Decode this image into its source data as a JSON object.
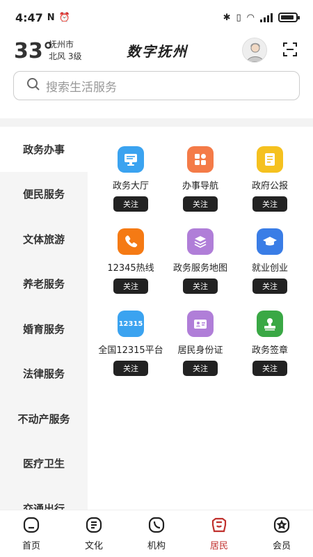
{
  "status_bar": {
    "time": "4:47"
  },
  "header": {
    "temperature": "33°",
    "city": "抚州市",
    "wind": "北风  3级",
    "app_title": "数字抚州"
  },
  "search": {
    "placeholder": "搜索生活服务"
  },
  "sidebar": {
    "items": [
      {
        "label": "政务办事",
        "active": true
      },
      {
        "label": "便民服务"
      },
      {
        "label": "文体旅游"
      },
      {
        "label": "养老服务"
      },
      {
        "label": "婚育服务"
      },
      {
        "label": "法律服务"
      },
      {
        "label": "不动产服务"
      },
      {
        "label": "医疗卫生"
      },
      {
        "label": "交通出行"
      }
    ]
  },
  "services": [
    {
      "label": "政务大厅",
      "icon": "monitor-icon",
      "color": "#3ba3f0",
      "follow": "关注"
    },
    {
      "label": "办事导航",
      "icon": "grid-apps-icon",
      "color": "#f47b48",
      "follow": "关注"
    },
    {
      "label": "政府公报",
      "icon": "document-icon",
      "color": "#f5c11f",
      "follow": "关注"
    },
    {
      "label": "12345热线",
      "icon": "phone-icon",
      "color": "#f57a14",
      "follow": "关注"
    },
    {
      "label": "政务服务地图",
      "icon": "layers-icon",
      "color": "#b07ed8",
      "follow": "关注"
    },
    {
      "label": "就业创业",
      "icon": "graduation-cap-icon",
      "color": "#3a7de6",
      "follow": "关注"
    },
    {
      "label": "全国12315平台",
      "icon": "badge-12315-icon",
      "icon_text": "12315",
      "color": "#3ba3f0",
      "follow": "关注"
    },
    {
      "label": "居民身份证",
      "icon": "id-card-icon",
      "color": "#b07ed8",
      "follow": "关注"
    },
    {
      "label": "政务签章",
      "icon": "stamp-icon",
      "color": "#3aa845",
      "follow": "关注"
    }
  ],
  "tabs": [
    {
      "label": "首页",
      "icon": "home-icon"
    },
    {
      "label": "文化",
      "icon": "book-icon"
    },
    {
      "label": "机构",
      "icon": "phone-circle-icon"
    },
    {
      "label": "居民",
      "icon": "resident-icon",
      "active": true
    },
    {
      "label": "会员",
      "icon": "star-badge-icon"
    }
  ],
  "colors": {
    "accent": "#c0312e",
    "follow_button": "#222222"
  }
}
